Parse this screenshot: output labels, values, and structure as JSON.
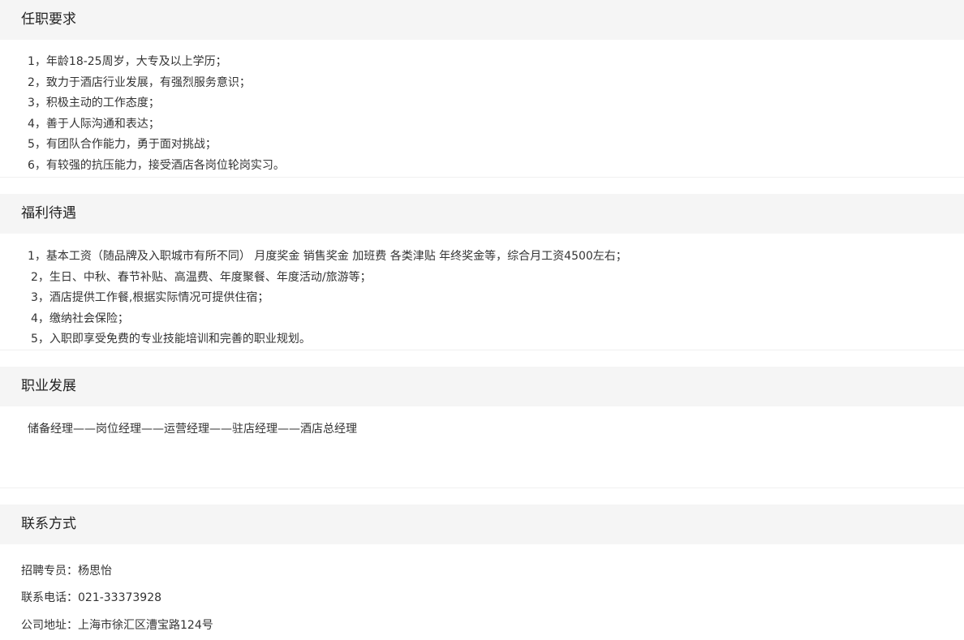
{
  "sections": {
    "requirements": {
      "title": "任职要求",
      "items": [
        "1，年龄18-25周岁，大专及以上学历；",
        "2，致力于酒店行业发展，有强烈服务意识；",
        "3，积极主动的工作态度；",
        "4，善于人际沟通和表达；",
        "5，有团队合作能力，勇于面对挑战；",
        "6，有较强的抗压能力，接受酒店各岗位轮岗实习。"
      ]
    },
    "benefits": {
      "title": "福利待遇",
      "items": [
        "1，基本工资（随品牌及入职城市有所不同）  月度奖金 销售奖金 加班费 各类津贴 年终奖金等，综合月工资4500左右；",
        "2，生日、中秋、春节补贴、高温费、年度聚餐、年度活动/旅游等；",
        "3，酒店提供工作餐,根据实际情况可提供住宿；",
        "4，缴纳社会保险；",
        "5，入职即享受免费的专业技能培训和完善的职业规划。"
      ]
    },
    "career": {
      "title": "职业发展",
      "path": "储备经理——岗位经理——运营经理——驻店经理——酒店总经理"
    },
    "contact": {
      "title": "联系方式",
      "recruiter_label": "招聘专员：",
      "recruiter_value": "杨思怡",
      "phone_label": "联系电话：",
      "phone_value": "021-33373928",
      "address_label": "公司地址：",
      "address_value": "上海市徐汇区漕宝路124号"
    }
  }
}
